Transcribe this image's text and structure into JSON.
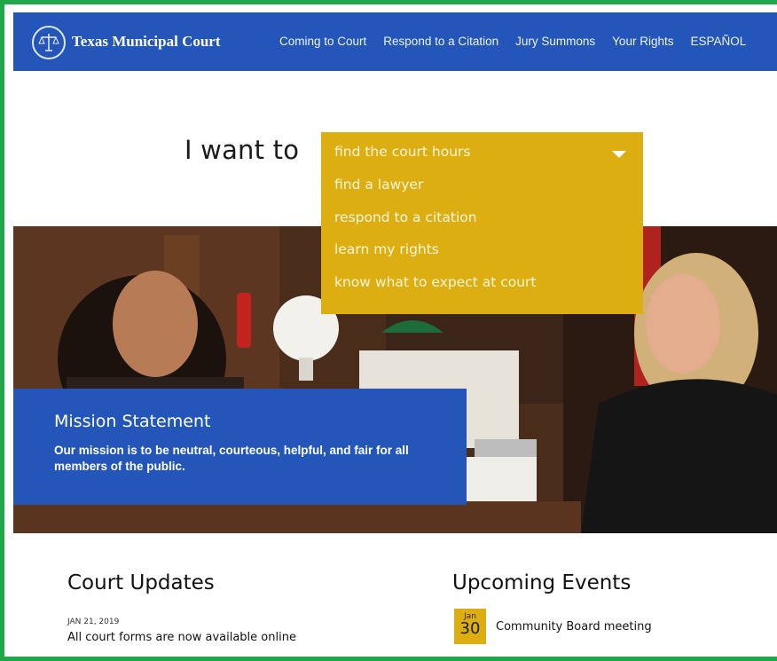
{
  "brand": {
    "name": "Texas Municipal Court",
    "logo_icon": "scales-of-justice-icon"
  },
  "nav": {
    "links": [
      "Coming to Court",
      "Respond to a Citation",
      "Jury Summons",
      "Your Rights",
      "ESPAÑOL"
    ]
  },
  "selector": {
    "prompt": "I want to",
    "selected": "find the court hours",
    "options": [
      "find a lawyer",
      "respond to a citation",
      "learn my rights",
      "know what to expect at court"
    ]
  },
  "mission": {
    "title": "Mission Statement",
    "text": "Our mission is to be neutral, courteous, helpful, and fair for all members of the public."
  },
  "updates": {
    "title": "Court Updates",
    "items": [
      {
        "date": "JAN 21, 2019",
        "text": "All court forms are now available online"
      }
    ]
  },
  "events": {
    "title": "Upcoming Events",
    "items": [
      {
        "month": "Jan",
        "day": "30",
        "name": "Community Board meeting"
      }
    ]
  },
  "colors": {
    "nav_blue": "#2356b8",
    "dropdown_gold": "#dcae12",
    "frame_green": "#1fa74a"
  }
}
